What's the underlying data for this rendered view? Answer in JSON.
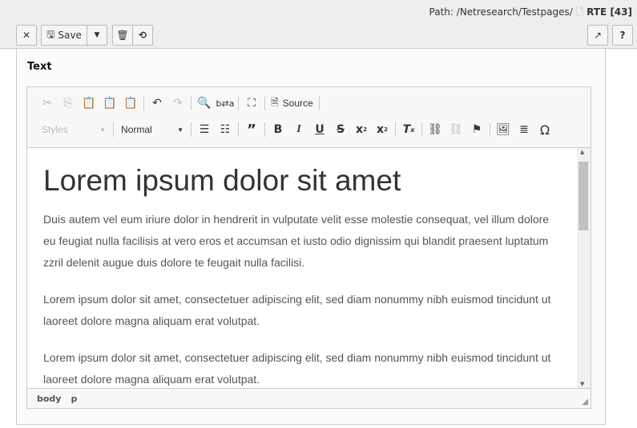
{
  "header": {
    "path_label": "Path:",
    "path": "/Netresearch/Testpages/",
    "page_title": "RTE [43]"
  },
  "toolbar": {
    "close_icon": "close-icon",
    "save_label": "Save",
    "save_icon": "floppy-icon",
    "delete_icon": "trash-icon",
    "history_icon": "history-icon",
    "open_new_icon": "external-link-icon",
    "help_label": "?"
  },
  "field": {
    "label": "Text"
  },
  "editor": {
    "toolbar": {
      "source_label": "Source",
      "styles_label": "Styles",
      "format_label": "Normal"
    },
    "content": {
      "heading": "Lorem ipsum dolor sit amet",
      "paragraphs": [
        "Duis autem vel eum iriure dolor in hendrerit in vulputate velit esse molestie consequat, vel illum dolore eu feugiat nulla facilisis at vero eros et accumsan et iusto odio dignissim qui blandit praesent luptatum zzril delenit augue duis dolore te feugait nulla facilisi.",
        "Lorem ipsum dolor sit amet, consectetuer adipiscing elit, sed diam nonummy nibh euismod tincidunt ut laoreet dolore magna aliquam erat volutpat.",
        "Lorem ipsum dolor sit amet, consectetuer adipiscing elit, sed diam nonummy nibh euismod tincidunt ut laoreet dolore magna aliquam erat volutpat."
      ]
    },
    "elements_path": [
      "body",
      "p"
    ]
  }
}
